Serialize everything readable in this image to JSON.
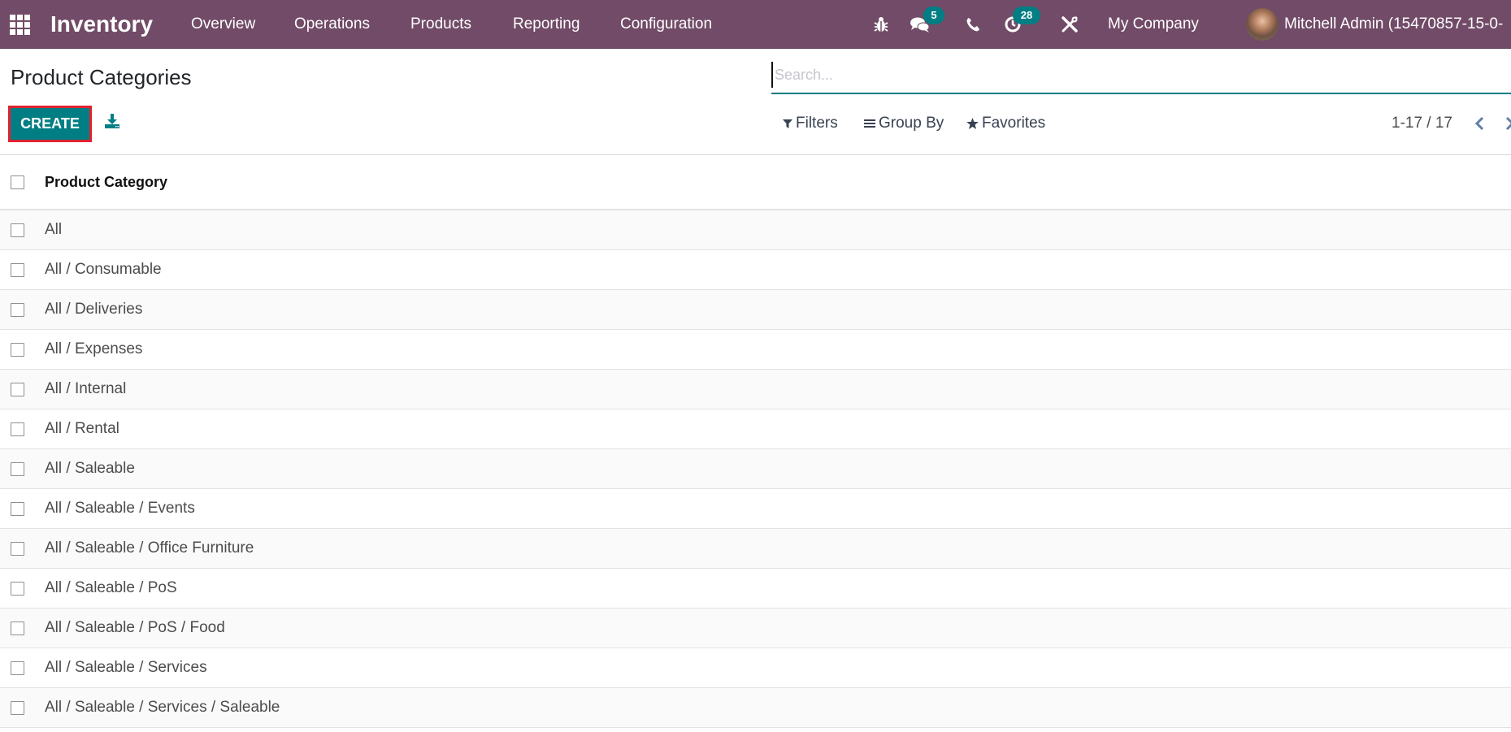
{
  "navbar": {
    "app_name": "Inventory",
    "menu": [
      "Overview",
      "Operations",
      "Products",
      "Reporting",
      "Configuration"
    ],
    "icons": {
      "apps": "apps-grid-icon",
      "debug": "bug-icon",
      "messages": "chat-icon",
      "phone": "phone-icon",
      "activities": "clock-icon",
      "settings": "tools-icon"
    },
    "messages_badge": "5",
    "activities_badge": "28",
    "company": "My Company",
    "user": "Mitchell Admin (15470857-15-0-"
  },
  "page": {
    "title": "Product Categories",
    "create_label": "CREATE",
    "download_icon": "download-icon"
  },
  "search": {
    "placeholder": "Search...",
    "value": "",
    "filters_label": "Filters",
    "groupby_label": "Group By",
    "favorites_label": "Favorites"
  },
  "pager": {
    "value": "1-17 / 17"
  },
  "colors": {
    "navbar": "#714b67",
    "primary": "#017e84",
    "highlight_border": "#e0212e"
  },
  "table": {
    "header": "Product Category",
    "rows": [
      "All",
      "All / Consumable",
      "All / Deliveries",
      "All / Expenses",
      "All / Internal",
      "All / Rental",
      "All / Saleable",
      "All / Saleable / Events",
      "All / Saleable / Office Furniture",
      "All / Saleable / PoS",
      "All / Saleable / PoS / Food",
      "All / Saleable / Services",
      "All / Saleable / Services / Saleable"
    ]
  }
}
